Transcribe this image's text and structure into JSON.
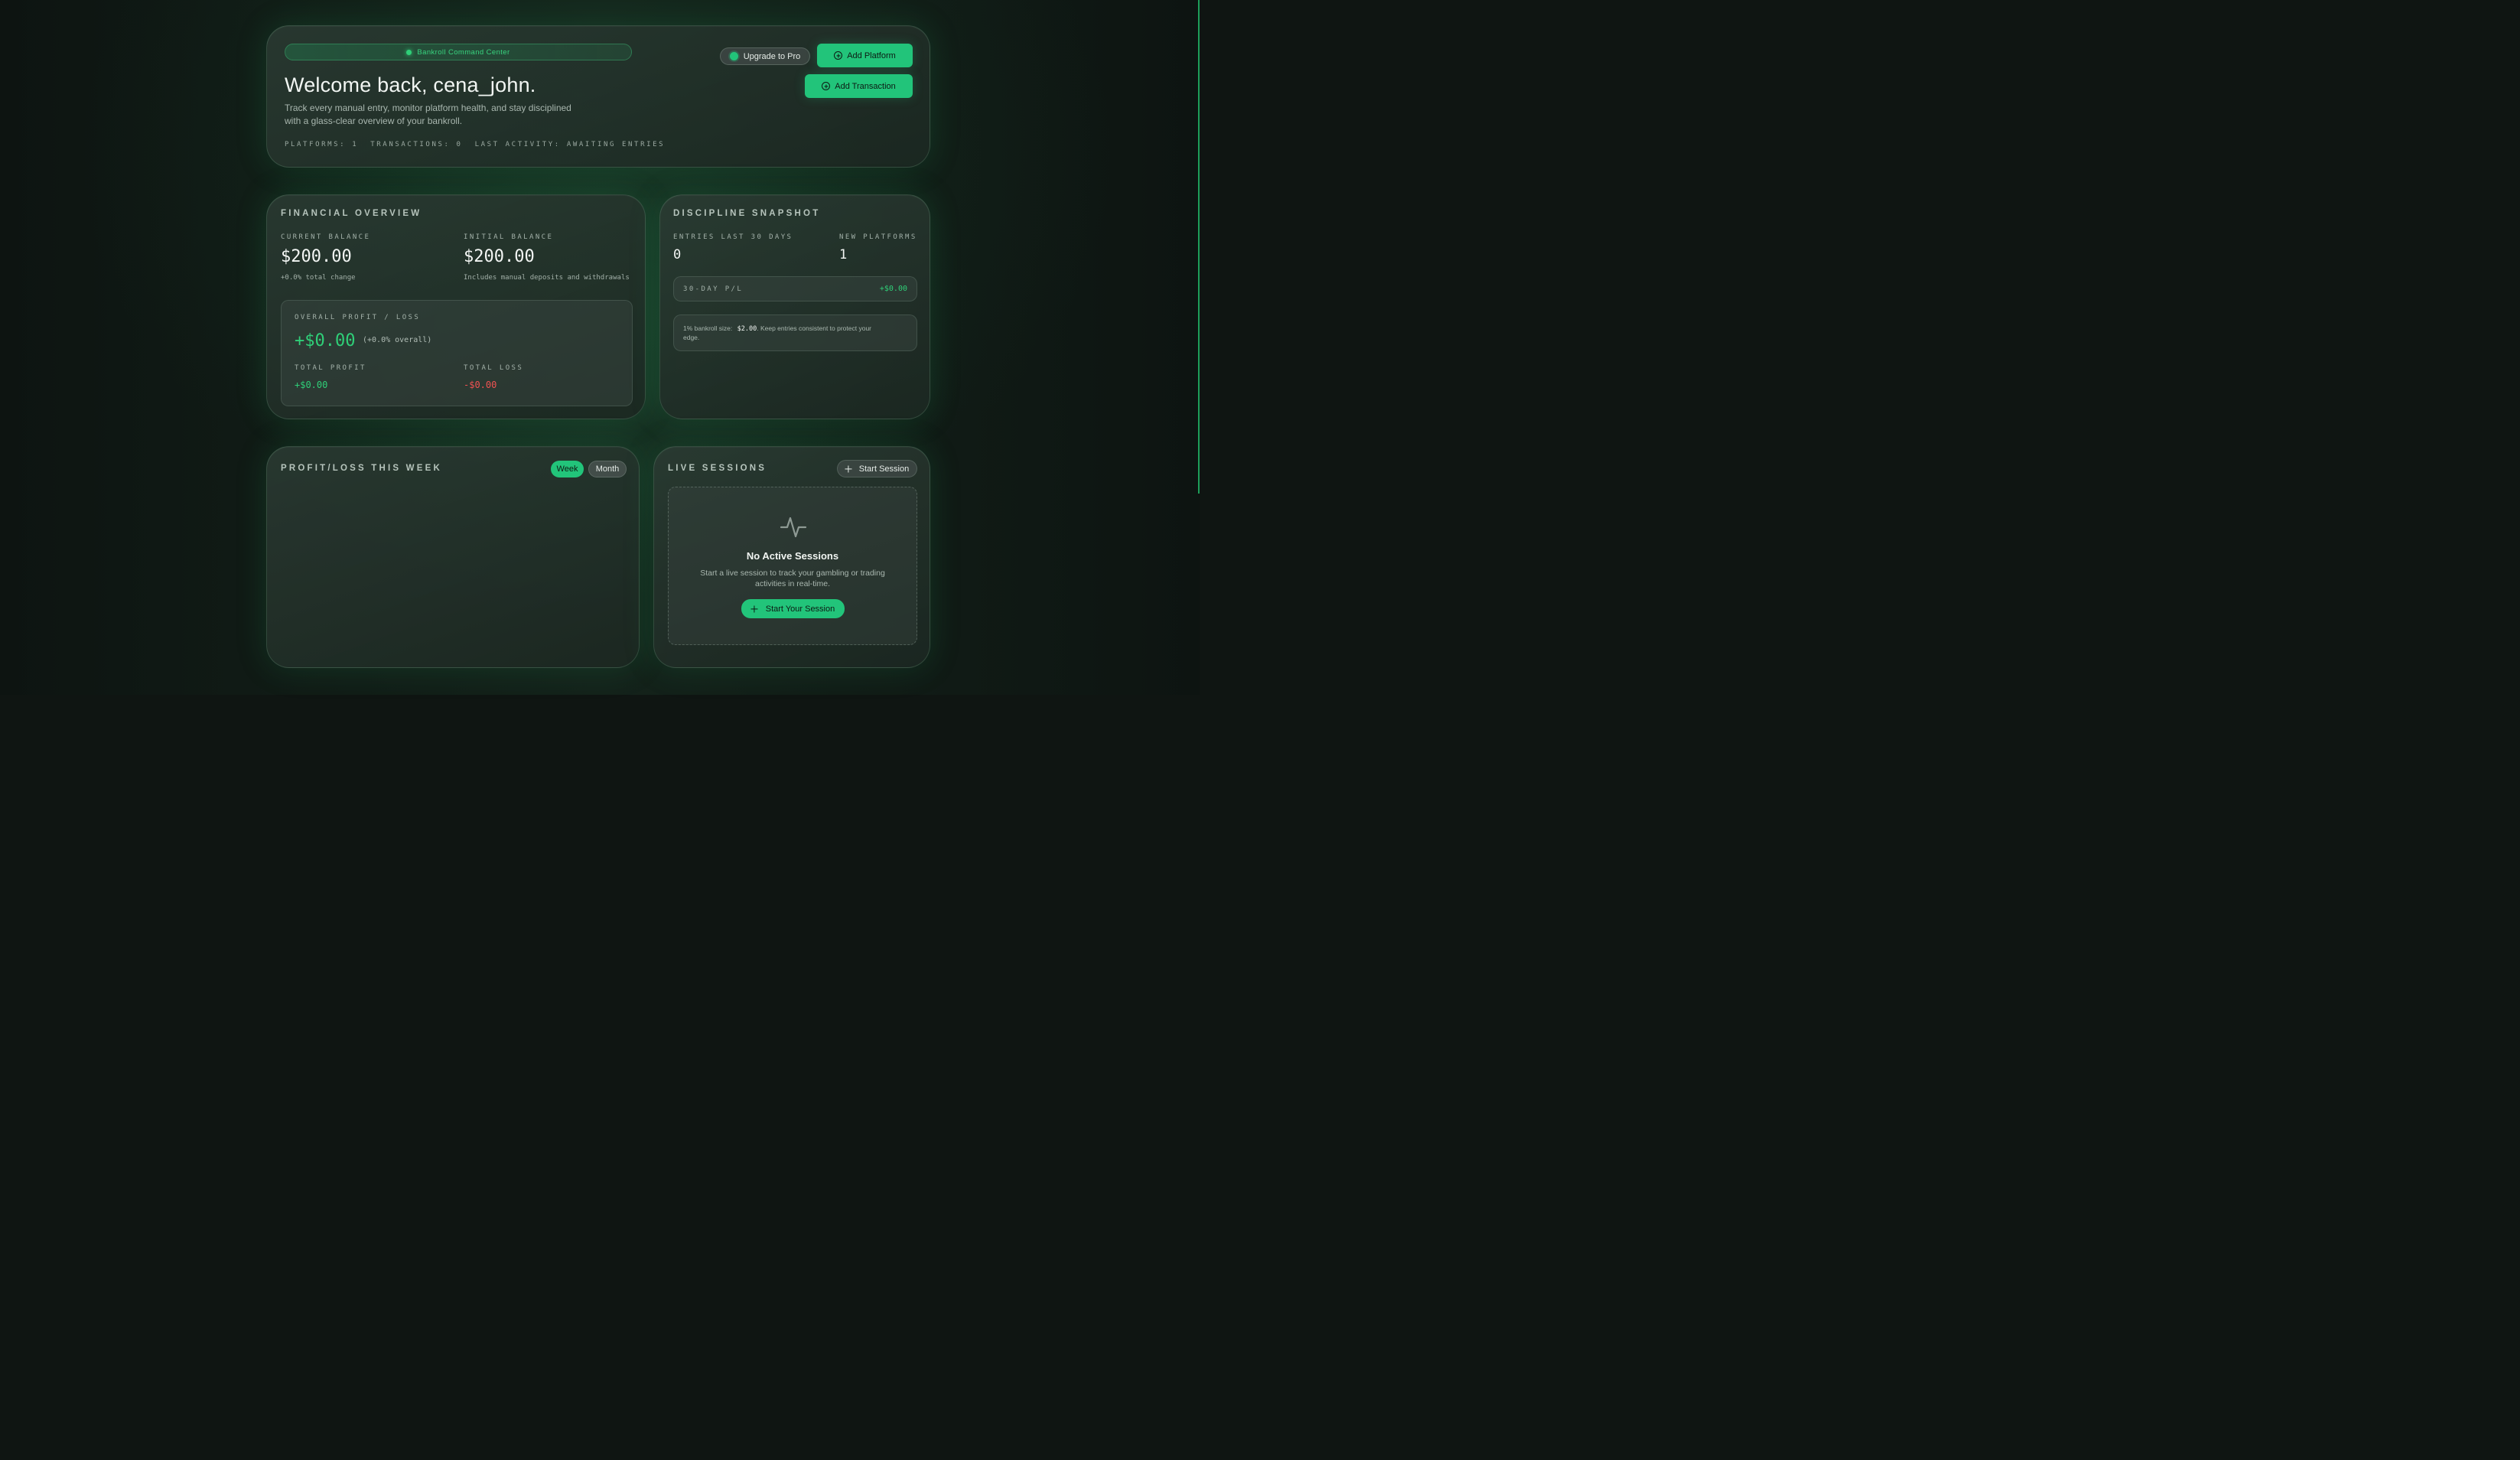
{
  "hero": {
    "badge": "Bankroll Command Center",
    "title": "Welcome back, cena_john.",
    "subtitle_line1": "Track every manual entry, monitor platform health, and stay disciplined",
    "subtitle_line2": "with a glass-clear overview of your bankroll.",
    "stats": "PLATFORMS: 1  TRANSACTIONS: 0  LAST ACTIVITY: AWAITING ENTRIES",
    "upgrade_label": "Upgrade to Pro",
    "add_platform_label": "Add Platform",
    "add_transaction_label": "Add Transaction"
  },
  "financial": {
    "title": "FINANCIAL OVERVIEW",
    "current_balance_label": "CURRENT BALANCE",
    "current_balance": "$200.00",
    "current_balance_note": "+0.0% total change",
    "initial_balance_label": "INITIAL BALANCE",
    "initial_balance": "$200.00",
    "initial_balance_note": "Includes manual deposits and withdrawals",
    "overall_label": "OVERALL PROFIT / LOSS",
    "overall_value": "+$0.00",
    "overall_pct": "(+0.0% overall)",
    "total_profit_label": "TOTAL PROFIT",
    "total_profit": "+$0.00",
    "total_loss_label": "TOTAL LOSS",
    "total_loss": "-$0.00"
  },
  "discipline": {
    "title": "DISCIPLINE SNAPSHOT",
    "entries_label": "ENTRIES LAST 30 DAYS",
    "entries_value": "0",
    "platforms_label": "NEW PLATFORMS",
    "platforms_value": "1",
    "pl_label": "30-DAY P/L",
    "pl_value": "+$0.00",
    "tip_prefix": "1% bankroll size:",
    "tip_amount": "$2.00",
    "tip_suffix": ". Keep entries consistent to protect your",
    "tip_line2": "edge."
  },
  "weekly": {
    "title": "PROFIT/LOSS THIS WEEK",
    "week_label": "Week",
    "month_label": "Month",
    "active_range": "Week"
  },
  "sessions": {
    "title": "LIVE SESSIONS",
    "start_label": "Start Session",
    "empty_title": "No Active Sessions",
    "empty_line1": "Start a live session to track your gambling or trading",
    "empty_line2": "activities in real-time.",
    "cta_label": "Start Your Session"
  },
  "colors": {
    "accent": "#22c47a",
    "positive": "#2fcf78",
    "negative": "#f05252",
    "background": "#0f1512"
  }
}
